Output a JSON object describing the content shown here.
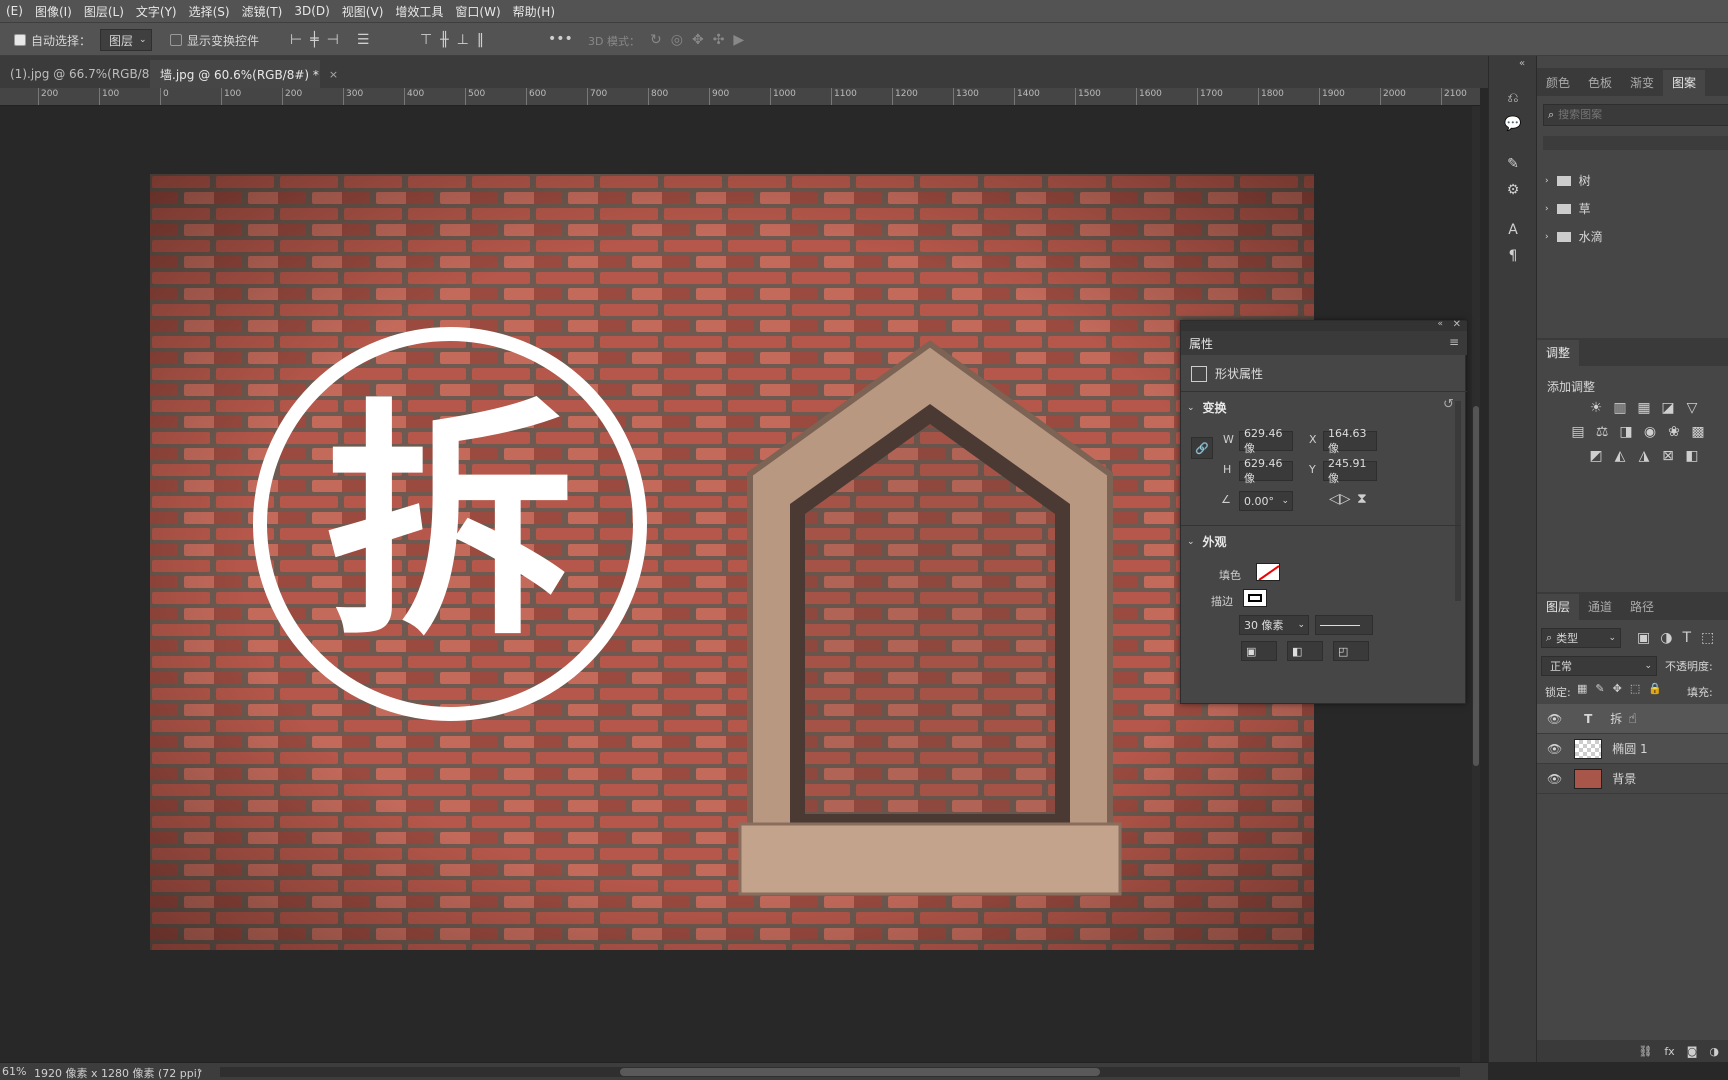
{
  "menu": [
    "(E)",
    "图像(I)",
    "图层(L)",
    "文字(Y)",
    "选择(S)",
    "滤镜(T)",
    "3D(D)",
    "视图(V)",
    "增效工具",
    "窗口(W)",
    "帮助(H)"
  ],
  "options": {
    "auto_select_label": "自动选择：",
    "auto_select_value": "图层",
    "show_transform_label": "显示变换控件",
    "mode_3d_label": "3D 模式："
  },
  "tabs": [
    {
      "label": "(1).jpg @ 66.7%(RGB/8)",
      "close": "×"
    },
    {
      "label": "墙.jpg @ 60.6%(RGB/8#) *",
      "close": "×"
    }
  ],
  "ruler_ticks": [
    "200",
    "100",
    "0",
    "100",
    "200",
    "300",
    "400",
    "500",
    "600",
    "700",
    "800",
    "900",
    "1000",
    "1100",
    "1200",
    "1300",
    "1400",
    "1500",
    "1600",
    "1700",
    "1800",
    "1900",
    "2000",
    "2100"
  ],
  "artwork": {
    "character": "拆"
  },
  "properties": {
    "title": "属性",
    "shape_label": "形状属性",
    "transform_label": "变换",
    "w_label": "W",
    "w_value": "629.46 像",
    "h_label": "H",
    "h_value": "629.46 像",
    "x_label": "X",
    "x_value": "164.63 像",
    "y_label": "Y",
    "y_value": "245.91 像",
    "angle_value": "0.00°",
    "appearance_label": "外观",
    "fill_label": "填色",
    "stroke_label": "描边",
    "stroke_width": "30 像素"
  },
  "right_panel": {
    "top_tabs": [
      "颜色",
      "色板",
      "渐变",
      "图案"
    ],
    "search_placeholder": "搜索图案",
    "folders": [
      "树",
      "草",
      "水滴"
    ],
    "adjust_tab": "调整",
    "adjust_title": "添加调整",
    "layer_tabs": [
      "图层",
      "通道",
      "路径"
    ],
    "filter_label": "类型",
    "blend_mode": "正常",
    "opacity_label": "不透明度:",
    "lock_label": "锁定:",
    "fill_label": "填充:",
    "layers": [
      {
        "name": "拆",
        "type": "text"
      },
      {
        "name": "椭圆 1",
        "type": "shape"
      },
      {
        "name": "背景",
        "type": "image"
      }
    ]
  },
  "status": {
    "zoom": "61%",
    "doc_info": "1920 像素 x 1280 像素 (72 ppi)"
  },
  "colors": {
    "brick_dark": "#8a4a3c",
    "brick_red": "#b5574a",
    "mortar": "#6e5a50",
    "window_frame": "#b99882"
  }
}
